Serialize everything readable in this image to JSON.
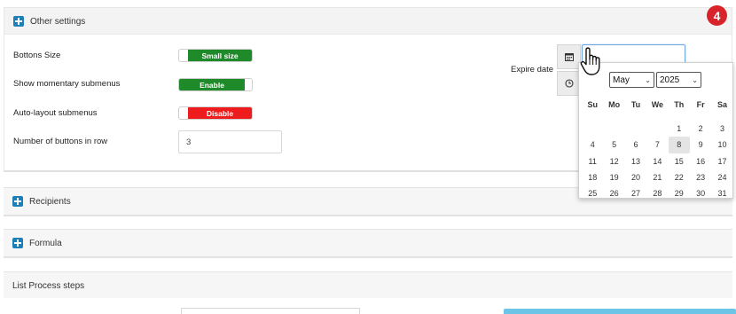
{
  "step_badge": "4",
  "other_settings": {
    "title": "Other settings",
    "buttons_size": {
      "label": "Bottons Size",
      "value": "Small size"
    },
    "momentary_submenus": {
      "label": "Show momentary submenus",
      "value": "Enable"
    },
    "auto_layout": {
      "label": "Auto-layout submenus",
      "value": "Disable"
    },
    "buttons_in_row": {
      "label": "Number of buttons in row",
      "value": "3"
    },
    "expire_date": {
      "label": "Expire date",
      "value": ""
    }
  },
  "calendar": {
    "month": "May",
    "year": "2025",
    "weekdays": [
      "Su",
      "Mo",
      "Tu",
      "We",
      "Th",
      "Fr",
      "Sa"
    ],
    "days": [
      "",
      "",
      "",
      "",
      "1",
      "2",
      "3",
      "4",
      "5",
      "6",
      "7",
      "8",
      "9",
      "10",
      "11",
      "12",
      "13",
      "14",
      "15",
      "16",
      "17",
      "18",
      "19",
      "20",
      "21",
      "22",
      "23",
      "24",
      "25",
      "26",
      "27",
      "28",
      "29",
      "30",
      "31"
    ],
    "highlighted_day": "8"
  },
  "sections": {
    "recipients": "Recipients",
    "formula": "Formula",
    "list_process_steps": "List Process steps"
  },
  "icons": {
    "expand": "plus-square-icon",
    "date_addon": "calendar-icon",
    "time_addon": "clock-icon",
    "cursor": "hand-pointer-icon"
  },
  "colors": {
    "accent": "#1d7fb8",
    "enable": "#1f8a2a",
    "disable": "#ee1c1c",
    "badge": "#d8232a"
  }
}
